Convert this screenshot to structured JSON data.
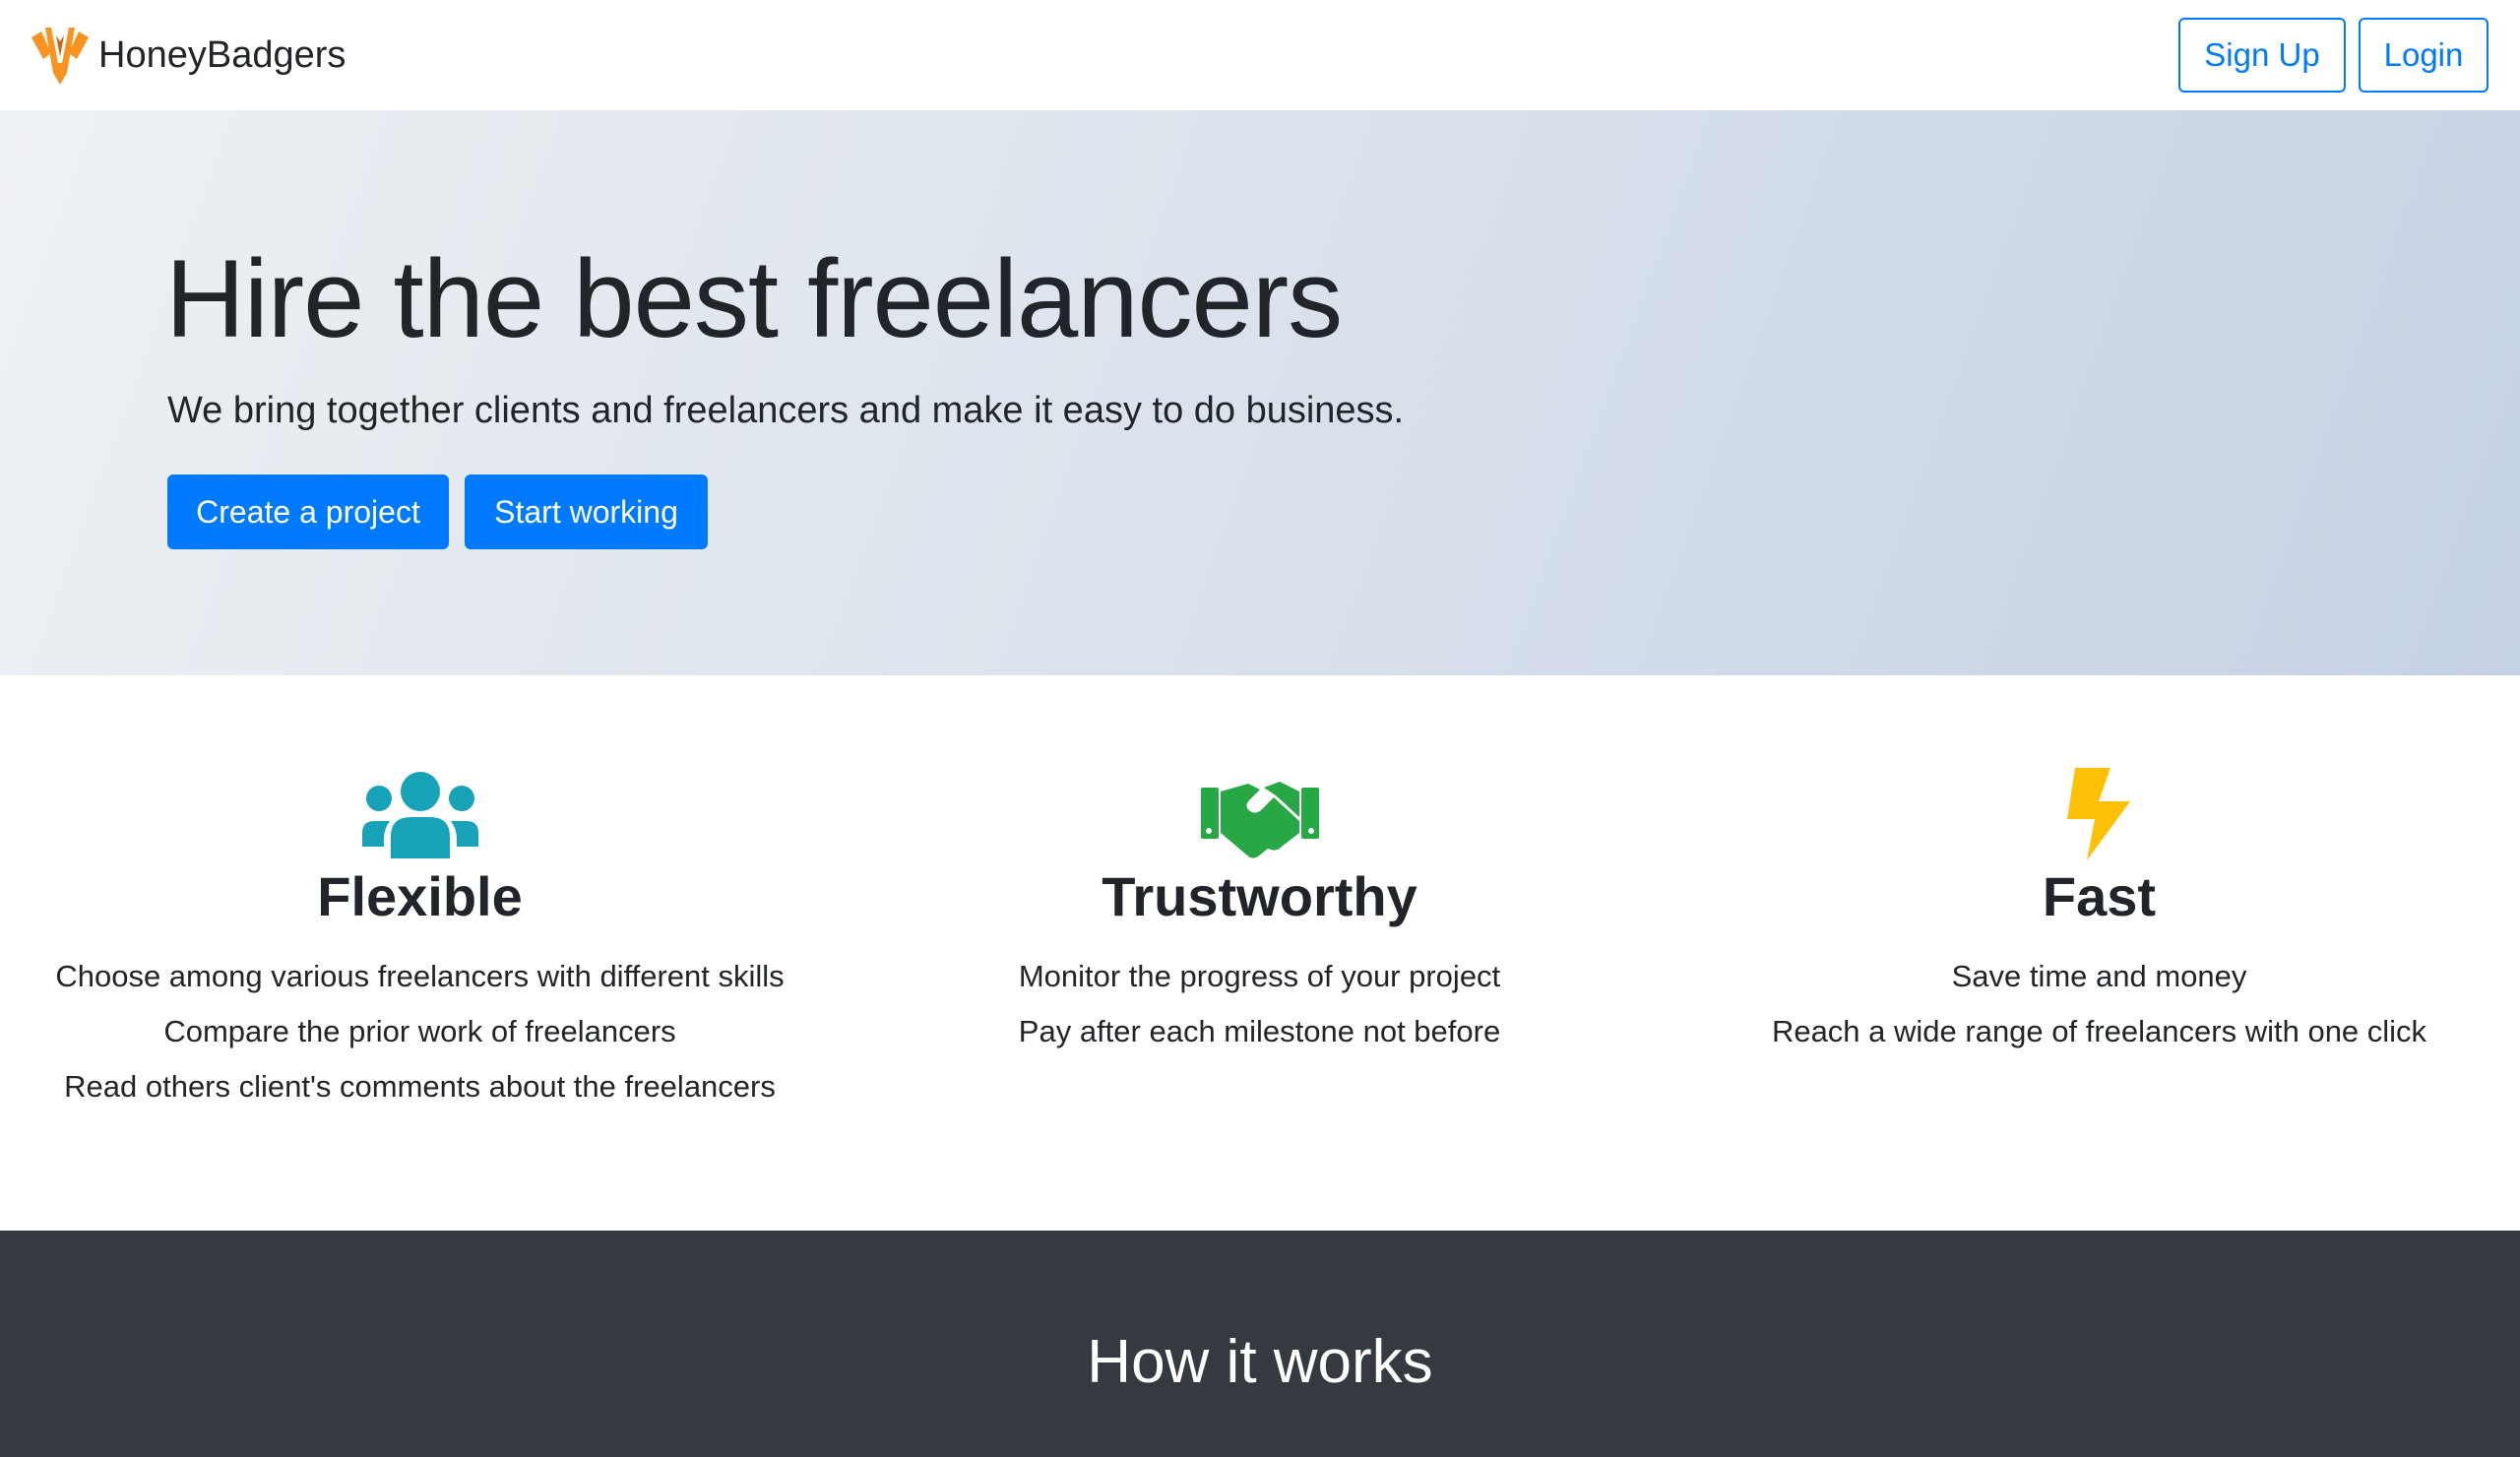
{
  "navbar": {
    "brand": "HoneyBadgers",
    "signup_label": "Sign Up",
    "login_label": "Login"
  },
  "hero": {
    "title": "Hire the best freelancers",
    "subtitle": "We bring together clients and freelancers and make it easy to do business.",
    "create_project_label": "Create a project",
    "start_working_label": "Start working"
  },
  "features": [
    {
      "icon": "users-icon",
      "color": "#17a2b8",
      "title": "Flexible",
      "lines": [
        "Choose among various freelancers with different skills",
        "Compare the prior work of freelancers",
        "Read others client's comments about the freelancers"
      ]
    },
    {
      "icon": "handshake-icon",
      "color": "#28a745",
      "title": "Trustworthy",
      "lines": [
        "Monitor the progress of your project",
        "Pay after each milestone not before"
      ]
    },
    {
      "icon": "lightning-bolt-icon",
      "color": "#ffc107",
      "title": "Fast",
      "lines": [
        "Save time and money",
        "Reach a wide range of freelancers with one click"
      ]
    }
  ],
  "how_it_works": {
    "title": "How it works"
  },
  "colors": {
    "primary": "#007bff",
    "dark": "#343a40",
    "logo_orange": "#f7931e"
  }
}
